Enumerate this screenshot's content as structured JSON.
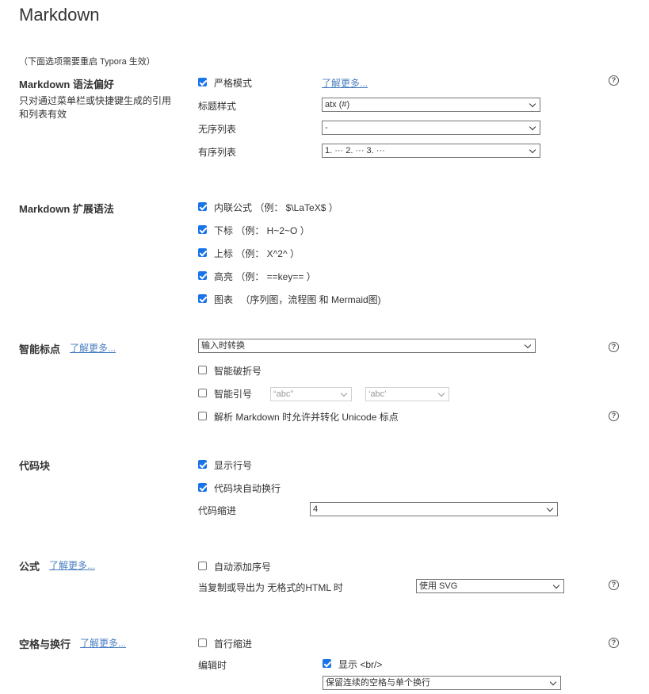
{
  "title": "Markdown",
  "restart_note": "（下面选项需要重启 Typora 生效）",
  "learn_more": "了解更多...",
  "help_glyph": "?",
  "syntax_pref": {
    "title": "Markdown 语法偏好",
    "desc": "只对通过菜单栏或快捷键生成的引用和列表有效",
    "strict_label": "严格模式",
    "strict_checked": true,
    "heading_label": "标题样式",
    "heading_value": "atx (#)",
    "unordered_label": "无序列表",
    "unordered_value": "-",
    "ordered_label": "有序列表",
    "ordered_value": "1. ··· 2. ··· 3. ···"
  },
  "extensions": {
    "title": "Markdown 扩展语法",
    "items": [
      {
        "label": "内联公式 （例： $\\LaTeX$ ）",
        "checked": true
      },
      {
        "label": "下标 （例： H~2~O ）",
        "checked": true
      },
      {
        "label": "上标 （例： X^2^ ）",
        "checked": true
      },
      {
        "label": "高亮 （例： ==key== ）",
        "checked": true
      },
      {
        "label": "图表 　（序列图，流程图 和 Mermaid图)",
        "checked": true
      }
    ]
  },
  "smart_punct": {
    "title": "智能标点",
    "mode_value": "输入时转换",
    "dash_label": "智能破折号",
    "dash_checked": false,
    "quotes_label": "智能引号",
    "quotes_checked": false,
    "double_quote_value": "“abc”",
    "single_quote_value": "‘abc’",
    "unicode_label": "解析 Markdown 时允许并转化 Unicode 标点",
    "unicode_checked": false
  },
  "code_block": {
    "title": "代码块",
    "line_numbers_label": "显示行号",
    "line_numbers_checked": true,
    "wrap_label": "代码块自动换行",
    "wrap_checked": true,
    "indent_label": "代码缩进",
    "indent_value": "4"
  },
  "math": {
    "title": "公式",
    "auto_number_label": "自动添加序号",
    "auto_number_checked": false,
    "export_label": "当复制或导出为 无格式的HTML 时",
    "export_value": "使用 SVG"
  },
  "whitespace": {
    "title": "空格与换行",
    "indent_label": "首行缩进",
    "indent_checked": false,
    "editing_label": "编辑时",
    "show_br_label": "显示 <br/>",
    "show_br_checked": true,
    "whitespace_value": "保留连续的空格与单个换行"
  }
}
